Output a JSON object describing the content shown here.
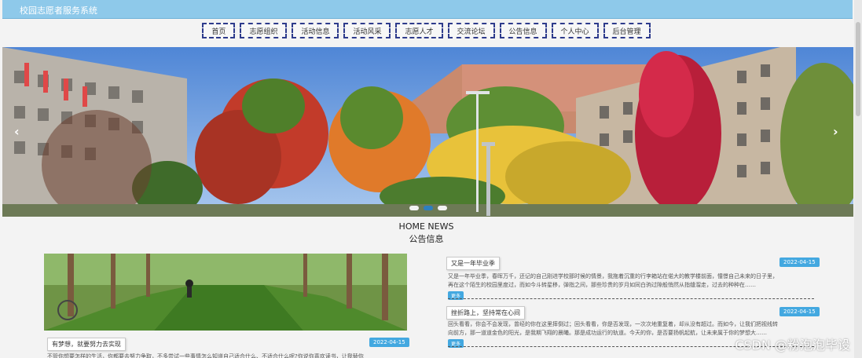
{
  "topbar": {
    "title": "校园志愿者服务系统"
  },
  "nav": [
    "首页",
    "志愿组织",
    "活动信息",
    "活动风采",
    "志愿人才",
    "交流论坛",
    "公告信息",
    "个人中心",
    "后台管理"
  ],
  "banner": {
    "prev_arrow": "‹",
    "next_arrow": "›",
    "slide_count": 3,
    "active_slide": 2
  },
  "section": {
    "title_en": "HOME NEWS",
    "title_cn": "公告信息"
  },
  "featured": {
    "title": "有梦想，就要努力去实现",
    "date": "2022-04-15",
    "excerpt": "不管你想要怎样的生活，你都要去努力争取，不多尝试一些事情怎么知道自己适合什么、不适合什么呢?你说你喜欢读书，让我替你"
  },
  "news": [
    {
      "title": "又是一年毕业季",
      "date": "2022-04-15",
      "excerpt": "又是一年毕业季，春晖万千，还记的自己刚进学校那时候的情景，我拖着沉重的行李箱站在偌大的教学楼前面，憧憬自己未来的日子里，",
      "excerpt2": "再在这个陌生的校园里度过，而如今斗转星移，弹指之间，那些珍贵的岁月如同白驹过隙般悄然从指缝溜走，过去的种种在……",
      "more": "更多"
    },
    {
      "title": "挫折路上，坚持常在心间",
      "date": "2022-04-15",
      "excerpt": "回头看看，你会不会发现，曾经的你在这里摔倒过；回头看看，你是否发现，一次次地重复着，却从没有超过。而如今，让我们把视线转",
      "excerpt2": "向前方，那一道道金色的阳光，是我期飞翔的晨曦。那是成功运行的轨道。今天的你，是否要扬帆起航，让未来属于你的梦想大……",
      "more": "更多"
    }
  ],
  "watermark": "CSDN @粉泡泡毕设",
  "colors": {
    "topbar": "#8ec9ea",
    "nav_border": "#2e3b8c",
    "accent": "#43a8e0"
  }
}
